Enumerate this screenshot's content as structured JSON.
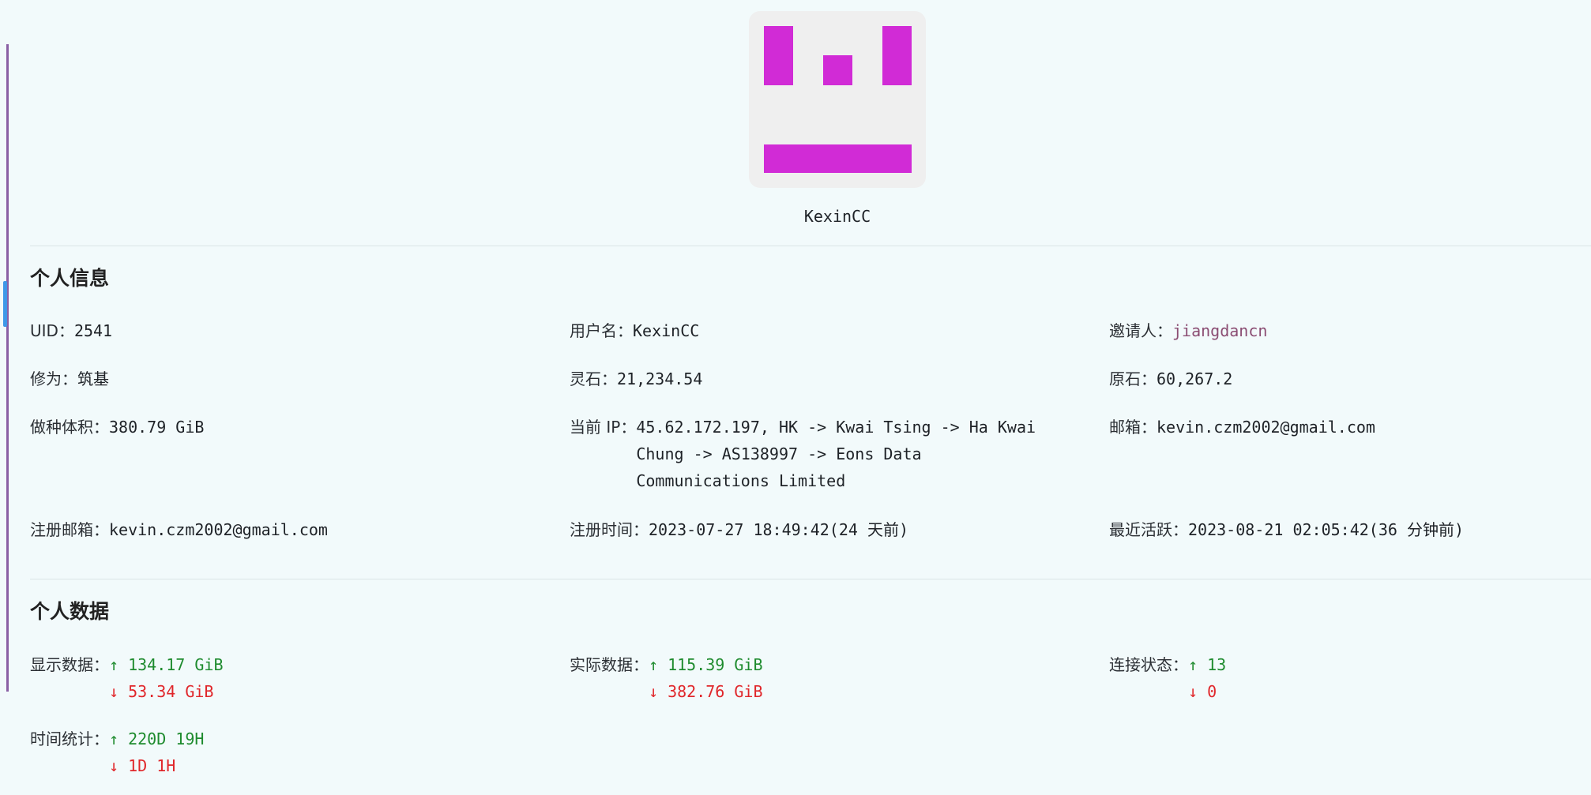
{
  "profile": {
    "username": "KexinCC",
    "avatar": {
      "color": "#d12bd6",
      "background": "#efefef"
    }
  },
  "personal_info": {
    "title": "个人信息",
    "uid_label": "UID：",
    "uid_value": "2541",
    "username_label": "用户名：",
    "username_value": "KexinCC",
    "inviter_label": "邀请人：",
    "inviter_value": "jiangdancn",
    "cultivation_label": "修为：",
    "cultivation_value": "筑基",
    "spirit_stone_label": "灵石：",
    "spirit_stone_value": "21,234.54",
    "raw_stone_label": "原石：",
    "raw_stone_value": "60,267.2",
    "seeding_label": "做种体积：",
    "seeding_value": "380.79 GiB",
    "ip_label": "当前 IP：",
    "ip_value": "45.62.172.197, HK -> Kwai Tsing -> Ha Kwai Chung -> AS138997 -> Eons Data Communications Limited",
    "email_label": "邮箱：",
    "email_value": "kevin.czm2002@gmail.com",
    "reg_email_label": "注册邮箱：",
    "reg_email_value": "kevin.czm2002@gmail.com",
    "reg_time_label": "注册时间：",
    "reg_time_value": "2023-07-27 18:49:42(24 天前)",
    "last_active_label": "最近活跃：",
    "last_active_value": "2023-08-21 02:05:42(36 分钟前)"
  },
  "personal_data": {
    "title": "个人数据",
    "display_label": "显示数据：",
    "display_up": "↑ 134.17 GiB",
    "display_down": "↓ 53.34 GiB",
    "actual_label": "实际数据：",
    "actual_up": "↑ 115.39 GiB",
    "actual_down": "↓ 382.76 GiB",
    "conn_label": "连接状态：",
    "conn_up": "↑ 13",
    "conn_down": "↓ 0",
    "time_label": "时间统计：",
    "time_up": "↑ 220D 19H",
    "time_down": "↓ 1D 1H"
  },
  "colors": {
    "upload": "#1e8b2e",
    "download": "#e0262a",
    "link": "#8b4d73"
  }
}
